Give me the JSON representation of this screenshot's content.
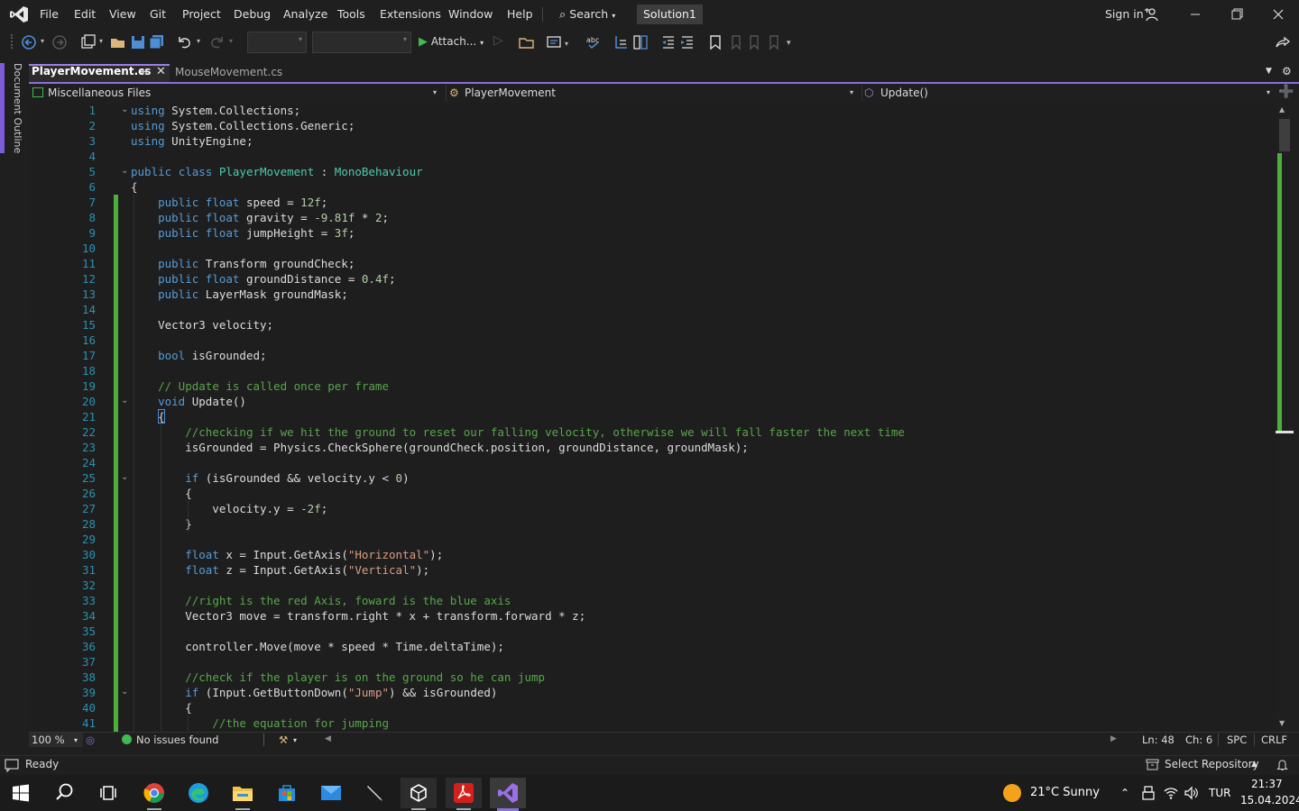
{
  "titlebar": {
    "menus": [
      "File",
      "Edit",
      "View",
      "Git",
      "Project",
      "Debug",
      "Analyze",
      "Tools",
      "Extensions",
      "Window",
      "Help"
    ],
    "search_label": "Search",
    "solution_name": "Solution1",
    "sign_in": "Sign in"
  },
  "toolbar": {
    "attach_label": "Attach..."
  },
  "doc_outline_label": "Document Outline",
  "tabs": [
    {
      "label": "PlayerMovement.cs",
      "active": true
    },
    {
      "label": "MouseMovement.cs",
      "active": false
    }
  ],
  "navbar": {
    "project": "Miscellaneous Files",
    "class": "PlayerMovement",
    "member": "Update()"
  },
  "editor": {
    "line_numbers": [
      "1",
      "2",
      "3",
      "4",
      "5",
      "6",
      "7",
      "8",
      "9",
      "10",
      "11",
      "12",
      "13",
      "14",
      "15",
      "16",
      "17",
      "18",
      "19",
      "20",
      "21",
      "22",
      "23",
      "24",
      "25",
      "26",
      "27",
      "28",
      "29",
      "30",
      "31",
      "32",
      "33",
      "34",
      "35",
      "36",
      "37",
      "38",
      "39",
      "40",
      "41"
    ],
    "lines": [
      "using System.Collections;",
      "using System.Collections.Generic;",
      "using UnityEngine;",
      "",
      "public class PlayerMovement : MonoBehaviour",
      "{",
      "    public float speed = 12f;",
      "    public float gravity = -9.81f * 2;",
      "    public float jumpHeight = 3f;",
      "",
      "    public Transform groundCheck;",
      "    public float groundDistance = 0.4f;",
      "    public LayerMask groundMask;",
      "",
      "    Vector3 velocity;",
      "",
      "    bool isGrounded;",
      "",
      "    // Update is called once per frame",
      "    void Update()",
      "    {",
      "        //checking if we hit the ground to reset our falling velocity, otherwise we will fall faster the next time",
      "        isGrounded = Physics.CheckSphere(groundCheck.position, groundDistance, groundMask);",
      "",
      "        if (isGrounded && velocity.y < 0)",
      "        {",
      "            velocity.y = -2f;",
      "        }",
      "",
      "        float x = Input.GetAxis(\"Horizontal\");",
      "        float z = Input.GetAxis(\"Vertical\");",
      "",
      "        //right is the red Axis, foward is the blue axis",
      "        Vector3 move = transform.right * x + transform.forward * z;",
      "",
      "        controller.Move(move * speed * Time.deltaTime);",
      "",
      "        //check if the player is on the ground so he can jump",
      "        if (Input.GetButtonDown(\"Jump\") && isGrounded)",
      "        {",
      "            //the equation for jumping"
    ]
  },
  "editor_status": {
    "zoom": "100 %",
    "issues": "No issues found",
    "line": "Ln: 48",
    "col": "Ch: 6",
    "whitespace": "SPC",
    "line_ending": "CRLF"
  },
  "statusbar": {
    "state": "Ready",
    "repo": "Select Repository"
  },
  "taskbar": {
    "weather": "21°C  Sunny",
    "language": "TUR",
    "time": "21:37",
    "date": "15.04.2024"
  }
}
